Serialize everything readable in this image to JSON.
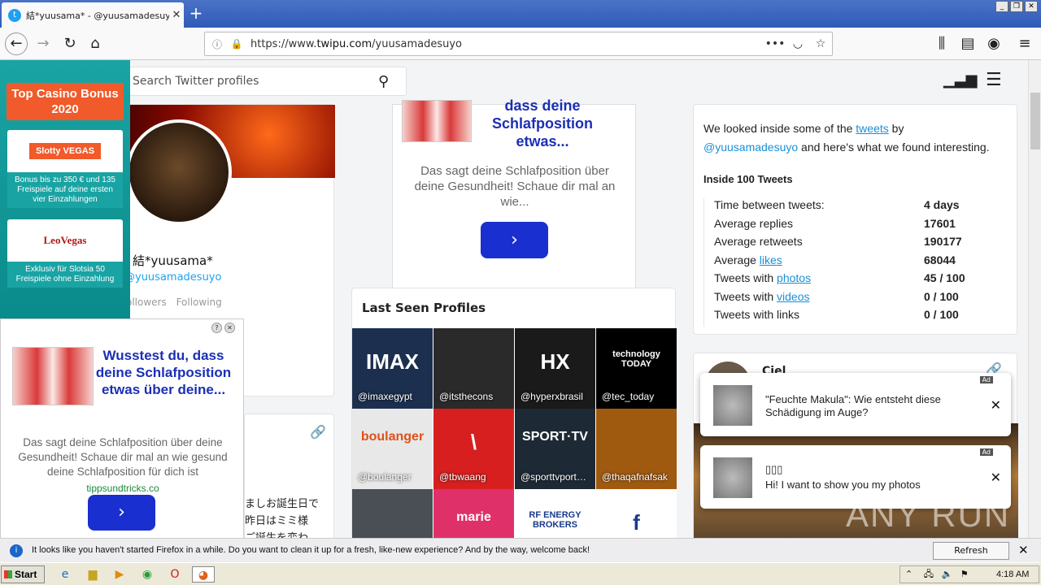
{
  "browser": {
    "tab_title": "結*yuusama* - @yuusamadesuyo",
    "url_prefix": "https://www.",
    "url_domain": "twipu.com",
    "url_path": "/yuusamadesuyo",
    "infobar_message": "It looks like you haven't started Firefox in a while. Do you want to clean it up for a fresh, like-new experience? And by the way, welcome back!",
    "refresh_button": "Refresh Firefox…"
  },
  "site": {
    "search_placeholder": "Search Twitter profiles"
  },
  "profile": {
    "name": "結*yuusama*",
    "handle": "@yuusamadesuyo",
    "followers_label": "ollowers",
    "following_label": "Following"
  },
  "mid_ad": {
    "headline": "dass deine Schlafposition etwas...",
    "body": "Das sagt deine Schlafposition über deine Gesundheit! Schaue dir mal an wie..."
  },
  "last_seen": {
    "title": "Last Seen Profiles",
    "tiles": [
      {
        "handle": "@imaxegypt",
        "logo": "IMAX",
        "bg": "#1c2f4f"
      },
      {
        "handle": "@itsthecons",
        "logo": "",
        "bg": "#2a2a2a"
      },
      {
        "handle": "@hyperxbrasil",
        "logo": "HX",
        "bg": "#1a1a1a"
      },
      {
        "handle": "@tec_today",
        "logo": "technology TODAY",
        "bg": "#000000"
      },
      {
        "handle": "@boulanger",
        "logo": "boulanger",
        "bg": "#e8e8e8"
      },
      {
        "handle": "@tbwaang",
        "logo": "\\",
        "bg": "#d81f1f"
      },
      {
        "handle": "@sporttvport…",
        "logo": "SPORT·TV",
        "bg": "#1d2a35"
      },
      {
        "handle": "@thaqafnafsak",
        "logo": "",
        "bg": "#a05a10"
      },
      {
        "handle": "",
        "logo": "",
        "bg": "#4a4f55"
      },
      {
        "handle": "",
        "logo": "marie",
        "bg": "#e0306a"
      },
      {
        "handle": "",
        "logo": "RF ENERGY BROKERS",
        "bg": "#ffffff"
      },
      {
        "handle": "",
        "logo": "f",
        "bg": "#ffffff"
      }
    ]
  },
  "insights": {
    "intro_1": "We looked inside some of the ",
    "intro_link": "tweets",
    "intro_2": " by",
    "intro_handle": "@yuusamadesuyo",
    "intro_3": " and here's what we found interesting.",
    "subtitle": "Inside 100 Tweets",
    "rows": [
      {
        "pre": "Time between tweets:",
        "link": "",
        "value": "4 days"
      },
      {
        "pre": "Average replies",
        "link": "",
        "value": "17601"
      },
      {
        "pre": "Average retweets",
        "link": "",
        "value": "190177"
      },
      {
        "pre": "Average ",
        "link": "likes",
        "value": "68044"
      },
      {
        "pre": "Tweets with ",
        "link": "photos",
        "value": "45 / 100"
      },
      {
        "pre": "Tweets with ",
        "link": "videos",
        "value": "0 / 100"
      },
      {
        "pre": "Tweets with links",
        "link": "",
        "value": "0 / 100"
      }
    ]
  },
  "card2": {
    "name": "Ciel"
  },
  "tweet_jp": {
    "line1": "ましお誕生日で",
    "line2": "昨日はミミ様",
    "line3": "ご誕生を変わ"
  },
  "casino": {
    "title": "Top Casino Bonus 2020",
    "offer1_logo": "Slotty VEGAS",
    "offer1_text": "Bonus bis zu 350 € und 135 Freispiele auf deine ersten vier Einzahlungen",
    "offer2_logo": "LeoVegas",
    "offer2_text": "Exklusiv für Slotsia 50 Freispiele ohne Einzahlung"
  },
  "popup_ad": {
    "headline": "Wusstest du, dass deine Schlafposition etwas über deine...",
    "body": "Das sagt deine Schlafposition über deine Gesundheit! Schaue dir mal an wie gesund deine Schlafposition für dich ist",
    "domain": "tippsundtricks.co"
  },
  "notifications": [
    {
      "text": "\"Feuchte Makula\": Wie entsteht diese Schädigung im Auge?",
      "badge": "Ad"
    },
    {
      "title": "▯▯▯",
      "text": "Hi! I want to show you my photos",
      "badge": "Ad"
    }
  ],
  "taskbar": {
    "start": "Start",
    "clock": "4:18 AM"
  },
  "watermark": "ANY RUN"
}
